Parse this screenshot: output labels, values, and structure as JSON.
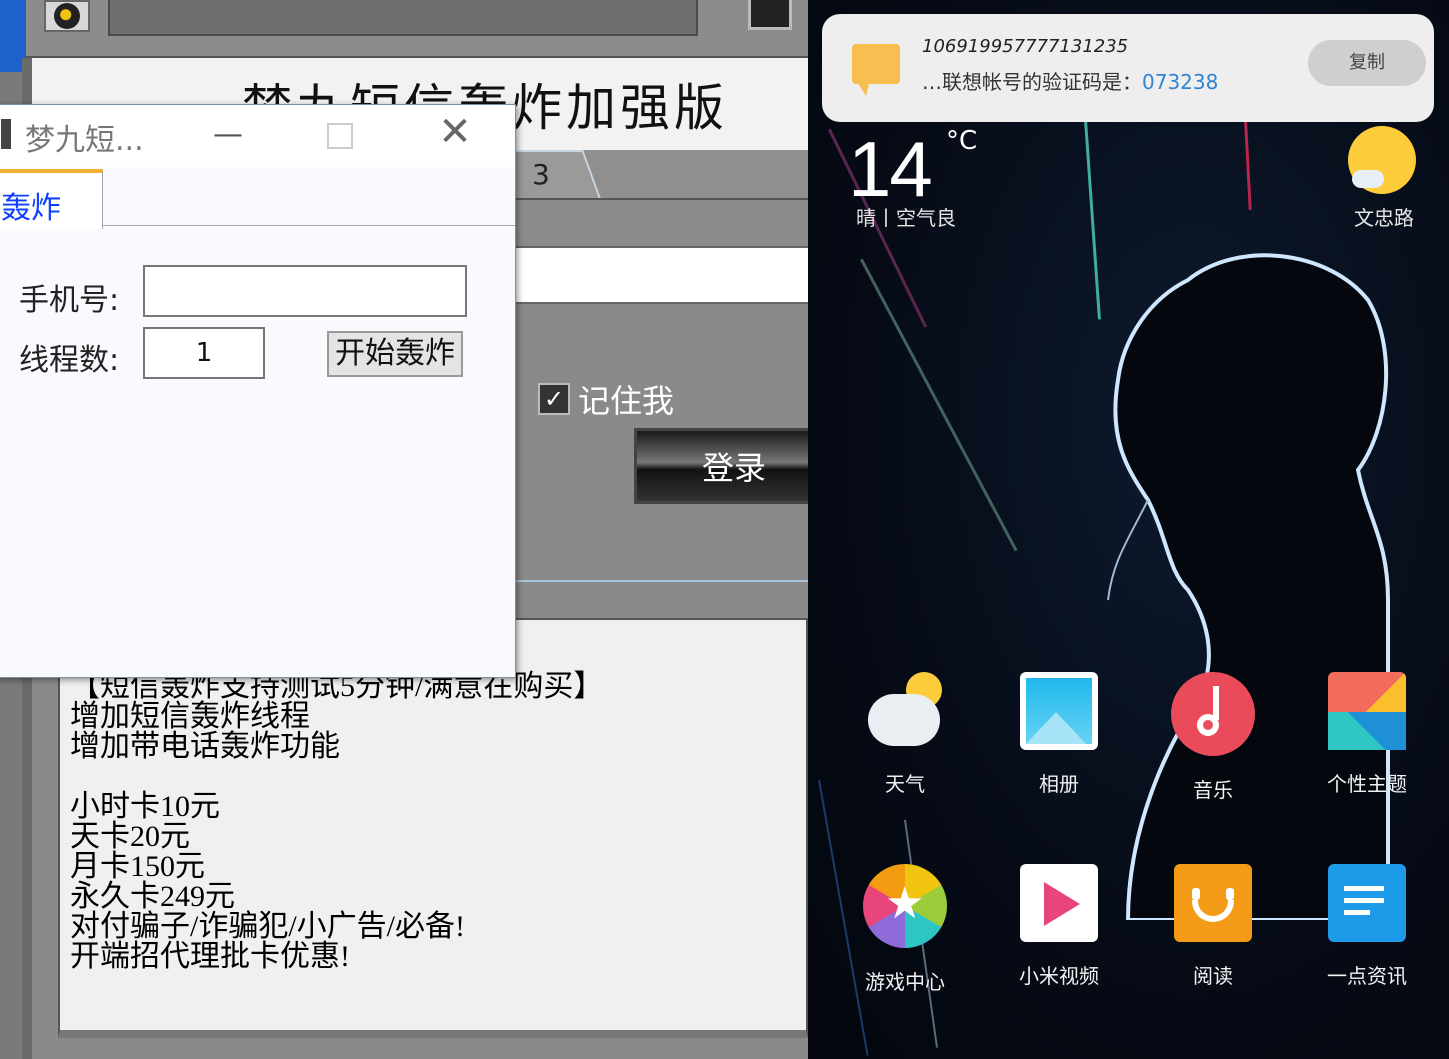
{
  "left_app": {
    "main_title": "梦九短信轰炸加强版",
    "back_tab_fragment": "3",
    "remember_label": "记住我",
    "remember_checked": true,
    "login_button": "登录",
    "info_lines": [
      "【短信轰炸支持测试5分钟/满意在购买】",
      "增加短信轰炸线程",
      "增加带电话轰炸功能",
      "",
      "小时卡10元",
      "天卡20元",
      "月卡150元",
      "永久卡249元",
      "对付骗子/诈骗犯/小广告/必备!",
      "开端招代理批卡优惠!"
    ],
    "dialog": {
      "title": "梦九短...",
      "minimize_glyph": "—",
      "close_glyph": "✕",
      "tab_label": "轰炸",
      "phone_label": "手机号:",
      "phone_value": "",
      "threads_label": "线程数:",
      "threads_value": "1",
      "start_button": "开始轰炸"
    }
  },
  "phone": {
    "notification": {
      "sender": "106919957777131235",
      "message": "…联想帐号的验证码是：",
      "code": "073238",
      "copy_button": "复制"
    },
    "weather": {
      "temperature": "14",
      "unit": "°C",
      "description": "晴丨空气良",
      "location": "文忠路"
    },
    "apps": [
      {
        "label": "天气",
        "icon": "weather-icon"
      },
      {
        "label": "相册",
        "icon": "gallery-icon"
      },
      {
        "label": "音乐",
        "icon": "music-icon"
      },
      {
        "label": "个性主题",
        "icon": "themes-icon"
      },
      {
        "label": "游戏中心",
        "icon": "game-center-icon"
      },
      {
        "label": "小米视频",
        "icon": "video-icon"
      },
      {
        "label": "阅读",
        "icon": "reader-icon"
      },
      {
        "label": "一点资讯",
        "icon": "news-icon"
      }
    ],
    "colors": {
      "notification_code": "#2f84d4",
      "accent_yellow": "#fccc3a"
    }
  }
}
